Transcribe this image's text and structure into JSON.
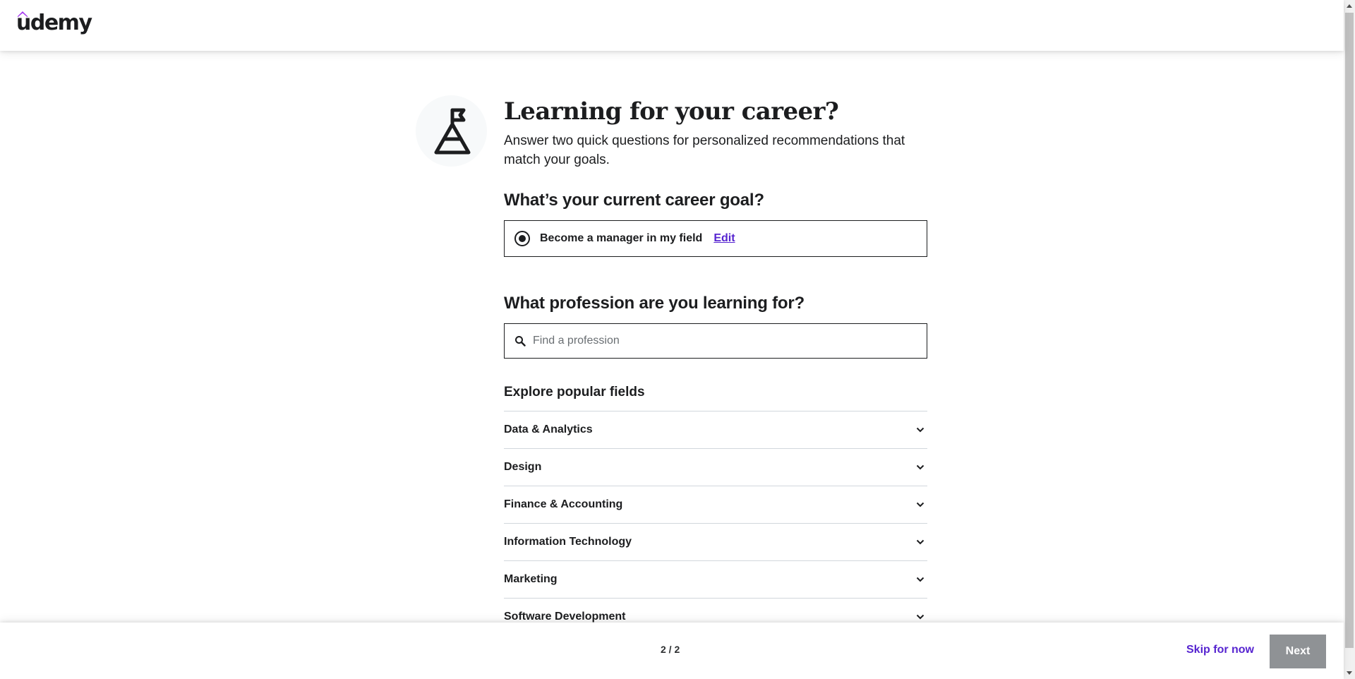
{
  "header": {
    "logo_text": "udemy",
    "brand_color": "#a435f0"
  },
  "hero": {
    "icon": "mountain-flag-icon",
    "title": "Learning for your career?",
    "subtitle": "Answer two quick questions for personalized recommendations that match your goals."
  },
  "goal_question": {
    "title": "What’s your current career goal?",
    "selected_option": "Become a manager in my field",
    "edit_label": "Edit"
  },
  "profession_question": {
    "title": "What profession are you learning for?",
    "search_placeholder": "Find a profession",
    "search_value": ""
  },
  "explore": {
    "title": "Explore popular fields",
    "fields": [
      {
        "label": "Data & Analytics"
      },
      {
        "label": "Design"
      },
      {
        "label": "Finance & Accounting"
      },
      {
        "label": "Information Technology"
      },
      {
        "label": "Marketing"
      },
      {
        "label": "Software Development"
      }
    ]
  },
  "footer": {
    "page_indicator": "2 / 2",
    "skip_label": "Skip for now",
    "next_label": "Next"
  },
  "colors": {
    "accent": "#5624d0",
    "text": "#1c1d1f",
    "next_disabled": "#8f9295"
  }
}
